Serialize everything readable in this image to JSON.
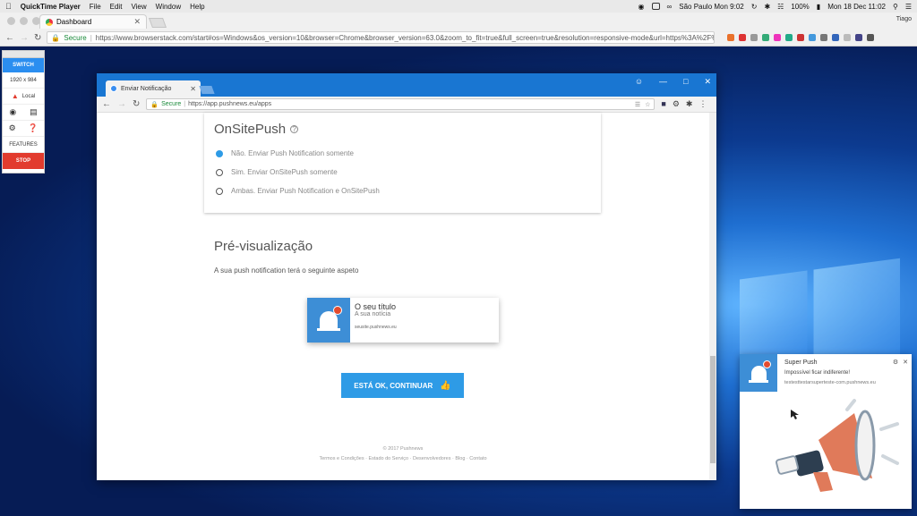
{
  "mac_menubar": {
    "app_name": "QuickTime Player",
    "items": [
      "File",
      "Edit",
      "View",
      "Window",
      "Help"
    ],
    "location_time": "São Paulo Mon 9:02",
    "battery": "100%",
    "datetime": "Mon 18 Dec  11:02"
  },
  "outer_browser": {
    "tab_title": "Dashboard",
    "user": "Tiago",
    "secure_label": "Secure",
    "url": "https://www.browserstack.com/start#os=Windows&os_version=10&browser=Chrome&browser_version=63.0&zoom_to_fit=true&full_screen=true&resolution=responsive-mode&url=https%3A%2F%2Fabr..."
  },
  "bs_panel": {
    "switch_label": "SWITCH",
    "resolution": "1920 x 984",
    "local_label": "Local",
    "features_label": "FEATURES",
    "stop_label": "STOP"
  },
  "inner_browser": {
    "tab_title": "Enviar Notificação",
    "secure_label": "Secure",
    "url": "https://app.pushnews.eu/apps"
  },
  "onsite": {
    "title": "OnSitePush",
    "options": [
      "Não. Enviar Push Notification somente",
      "Sim. Enviar OnSitePush somente",
      "Ambas. Enviar Push Notification e OnSitePush"
    ],
    "selected_index": 0
  },
  "preview": {
    "title": "Pré-visualização",
    "subtitle": "A sua push notification terá o seguinte aspeto",
    "notif_title": "O seu título",
    "notif_body": "A sua notícia",
    "notif_site": "seusite.pushnews.eu"
  },
  "cta": {
    "label": "ESTÁ OK, CONTINUAR"
  },
  "footer": {
    "copyright": "© 2017 Pushnews",
    "links": "Termos e Condições · Estado do Serviço · Desenvolvedores · Blog · Contato"
  },
  "popup": {
    "title": "Super Push",
    "message": "Impossível ficar indiferente!",
    "site": "testesttestarsuperteste-com.pushnews.eu"
  },
  "colors": {
    "accent": "#2e9be6",
    "titlebar": "#1976d2",
    "stop": "#e23b2e",
    "notif_icon_bg": "#3d8ed6"
  }
}
